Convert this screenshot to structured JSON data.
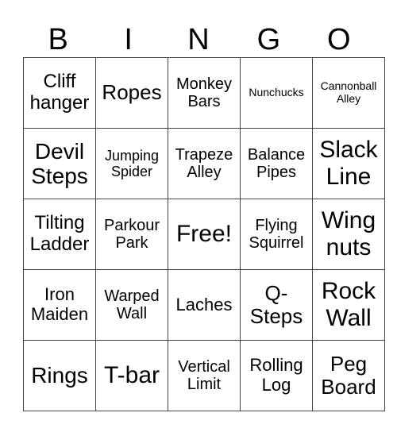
{
  "header": [
    "B",
    "I",
    "N",
    "G",
    "O"
  ],
  "rows": [
    [
      "Cliff hanger",
      "Ropes",
      "Monkey Bars",
      "Nunchucks",
      "Cannonball Alley"
    ],
    [
      "Devil Steps",
      "Jumping Spider",
      "Trapeze Alley",
      "Balance Pipes",
      "Slack Line"
    ],
    [
      "Tilting Ladder",
      "Parkour Park",
      "Free!",
      "Flying Squirrel",
      "Wing nuts"
    ],
    [
      "Iron Maiden",
      "Warped Wall",
      "Laches",
      "Q-Steps",
      "Rock Wall"
    ],
    [
      "Rings",
      "T-bar",
      "Vertical Limit",
      "Rolling Log",
      "Peg Board"
    ]
  ]
}
